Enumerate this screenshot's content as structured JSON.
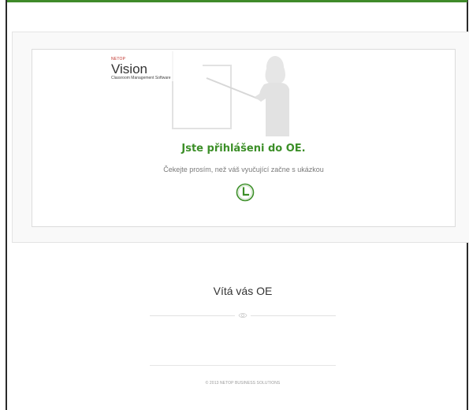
{
  "logo": {
    "brand_top": "NETOP",
    "brand_main": "Vision",
    "brand_sub": "Classroom Management Software"
  },
  "status": {
    "title": "Jste přihlášeni do OE.",
    "message": "Čekejte prosím, než váš vyučující začne s ukázkou"
  },
  "welcome": {
    "title": "Vítá vás OE"
  },
  "footer": {
    "copyright": "© 2013 NETOP BUSINESS SOLUTIONS"
  },
  "colors": {
    "accent": "#3c8f28",
    "brand_red": "#c0322b"
  },
  "icons": {
    "teacher": "teacher-illustration",
    "clock": "clock-icon",
    "eye": "eye-icon"
  }
}
